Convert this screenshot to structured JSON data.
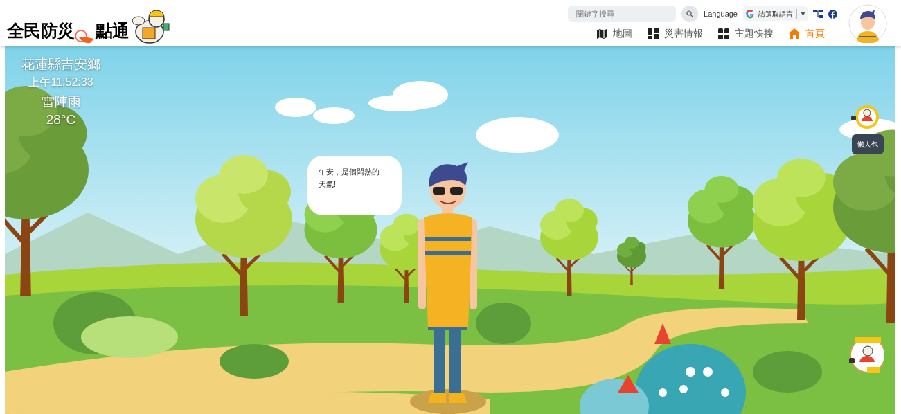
{
  "header": {
    "logo": {
      "text_left": "全民防災",
      "text_right": "點通"
    },
    "search": {
      "placeholder": "關鍵字搜尋"
    },
    "language_label": "Language",
    "language_select": "請選取語言",
    "nav": [
      {
        "label": "地圖",
        "kind": "map",
        "selected": false
      },
      {
        "label": "災害情報",
        "kind": "blocks",
        "selected": false
      },
      {
        "label": "主題快搜",
        "kind": "grid",
        "selected": false
      },
      {
        "label": "首頁",
        "kind": "home",
        "selected": true
      }
    ]
  },
  "scene": {
    "location": "花蓮縣吉安鄉",
    "time": "上午11:52:33",
    "weather": "雷陣雨",
    "temperature": "28°C",
    "speech": "午安，是個悶熱的天氣!",
    "side_button": "懶人包"
  }
}
